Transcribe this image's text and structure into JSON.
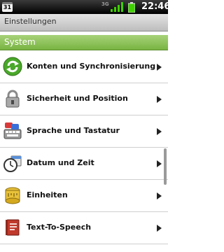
{
  "status_bar": {
    "calendar_day": "31",
    "network_type": "3G",
    "time": "22:46",
    "icons": [
      "calendar-icon",
      "signal-icon",
      "battery-icon"
    ]
  },
  "title_bar": {
    "title": "Einstellungen"
  },
  "section": {
    "label": "System"
  },
  "settings": {
    "items": [
      {
        "label": "Konten und Synchronisierung",
        "icon": "sync-icon"
      },
      {
        "label": "Sicherheit und Position",
        "icon": "lock-icon"
      },
      {
        "label": "Sprache und Tastatur",
        "icon": "keyboard-icon"
      },
      {
        "label": "Datum und Zeit",
        "icon": "clock-icon"
      },
      {
        "label": "Einheiten",
        "icon": "ruler-icon"
      },
      {
        "label": "Text-To-Speech",
        "icon": "speech-icon"
      }
    ]
  },
  "colors": {
    "section_green": "#78b442",
    "status_bar": "#000000",
    "signal_green": "#3fd000"
  }
}
